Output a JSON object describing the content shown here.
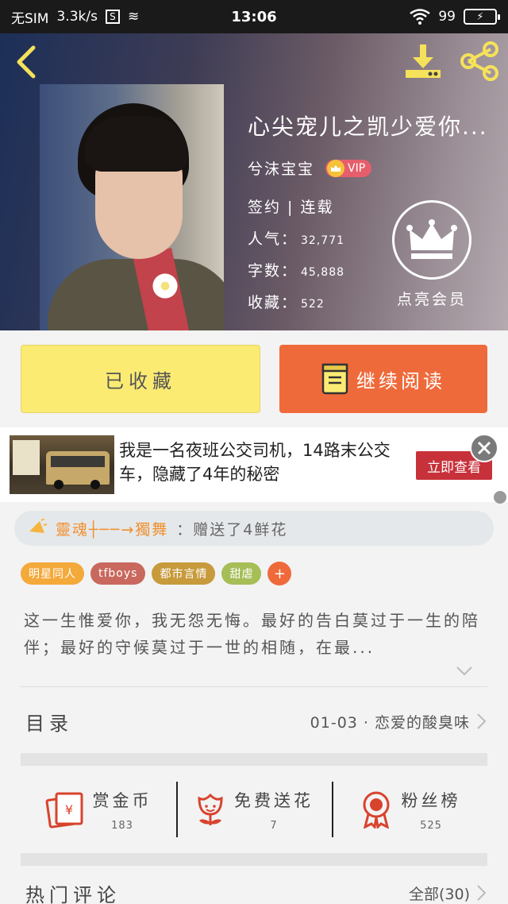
{
  "status_bar": {
    "carrier": "无SIM",
    "speed": "3.3k/s",
    "sim_icon_text": "S",
    "time": "13:06",
    "battery": "99"
  },
  "book": {
    "title": "心尖宠儿之凯少爱你...",
    "author": "兮沫宝宝",
    "vip": "VIP",
    "status": "签约 | 连载",
    "popularity_label": "人气：",
    "popularity": "32,771",
    "words_label": "字数：",
    "words": "45,888",
    "favorites_label": "收藏：",
    "favorites": "522",
    "member_label": "点亮会员"
  },
  "actions": {
    "collected_label": "已收藏",
    "read_label": "继续阅读"
  },
  "ad": {
    "text": "我是一名夜班公交司机，14路末公交车，隐藏了4年的秘密",
    "button_label": "立即查看"
  },
  "fan": {
    "name": "靈魂┼──→獨舞",
    "action": "：赠送了4鲜花"
  },
  "tags": [
    {
      "label": "明星同人",
      "color": "#f4a93b"
    },
    {
      "label": "tfboys",
      "color": "#c9685e"
    },
    {
      "label": "都市言情",
      "color": "#c79a3c"
    },
    {
      "label": "甜虐",
      "color": "#a6be56"
    }
  ],
  "tag_add": "+",
  "synopsis": "这一生惟爱你，我无怨无悔。最好的告白莫过于一生的陪伴；最好的守候莫过于一世的相随，在最...",
  "catalog": {
    "label": "目录",
    "latest": "01-03 · 恋爱的酸臭味"
  },
  "stats": [
    {
      "label": "赏金币",
      "count": "183",
      "icon": "red-envelope-icon"
    },
    {
      "label": "免费送花",
      "count": "7",
      "icon": "flower-icon"
    },
    {
      "label": "粉丝榜",
      "count": "525",
      "icon": "medal-icon"
    }
  ],
  "hot_comments": {
    "label": "热门评论",
    "all": "全部(30)"
  },
  "colors": {
    "accent_orange": "#ef6a3a",
    "collected_yellow": "#fbeb73",
    "stat_icon_red": "#d8432e"
  }
}
